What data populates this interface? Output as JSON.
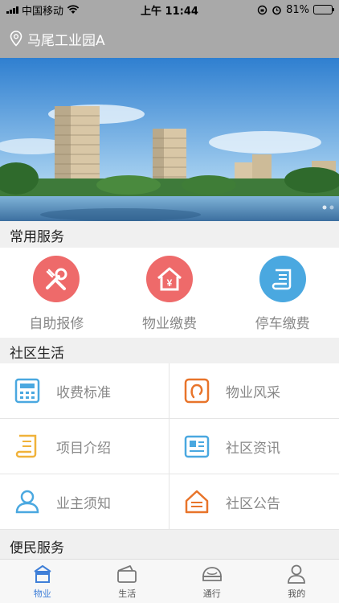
{
  "status_bar": {
    "carrier": "中国移动",
    "time": "上午 11:44",
    "battery": "81%",
    "battery_level": 0.81
  },
  "location": {
    "name": "马尾工业园A",
    "icon": "location-pin-icon"
  },
  "banner": {
    "image": "residential-towers-lake-illustration",
    "page_indicator": "•"
  },
  "sections": {
    "common_services": "常用服务",
    "community_life": "社区生活",
    "convenience": "便民服务"
  },
  "services": [
    {
      "label": "自助报修",
      "icon": "repair-tools-icon",
      "color": "#ee6a6a"
    },
    {
      "label": "物业缴费",
      "icon": "property-fee-icon",
      "color": "#ee6a6a"
    },
    {
      "label": "停车缴费",
      "icon": "parking-fee-icon",
      "color": "#4aa8e0"
    }
  ],
  "life_items": [
    {
      "label": "收费标准",
      "icon": "calculator-icon",
      "color": "#4aa8e0"
    },
    {
      "label": "物业风采",
      "icon": "property-style-icon",
      "color": "#e8742a"
    },
    {
      "label": "项目介绍",
      "icon": "scroll-icon",
      "color": "#f0b23a"
    },
    {
      "label": "社区资讯",
      "icon": "news-icon",
      "color": "#4aa8e0"
    },
    {
      "label": "业主须知",
      "icon": "owner-icon",
      "color": "#4aa8e0"
    },
    {
      "label": "社区公告",
      "icon": "announcement-icon",
      "color": "#e8742a"
    }
  ],
  "tabs": [
    {
      "label": "物业",
      "icon": "house-icon",
      "active": true
    },
    {
      "label": "生活",
      "icon": "wallet-icon",
      "active": false
    },
    {
      "label": "通行",
      "icon": "car-icon",
      "active": false
    },
    {
      "label": "我的",
      "icon": "person-icon",
      "active": false
    }
  ],
  "colors": {
    "header_bg": "#a9a9a9",
    "accent": "#3f7fd8",
    "label_gray": "#888888"
  }
}
